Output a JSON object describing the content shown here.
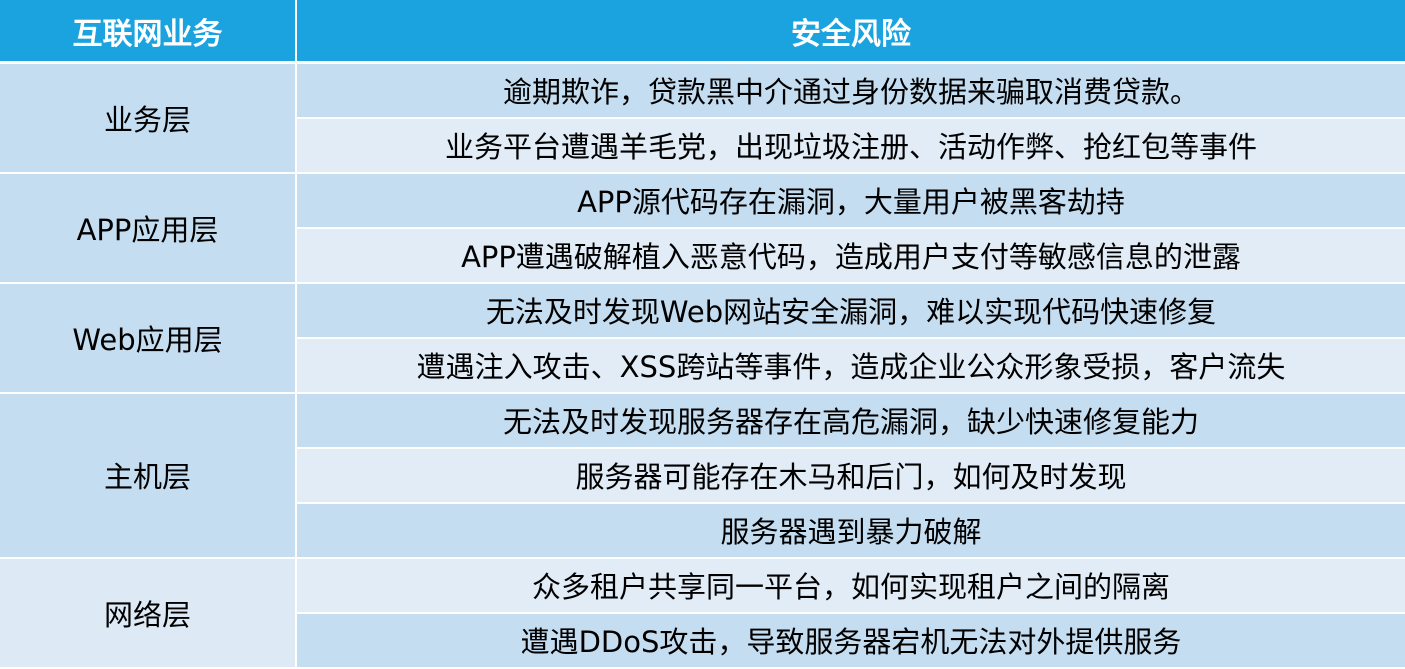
{
  "header": {
    "layer_label": "互联网业务",
    "risk_label": "安全风险"
  },
  "groups": [
    {
      "layer": "业务层",
      "risks": [
        "逾期欺诈，贷款黑中介通过身份数据来骗取消费贷款。",
        "业务平台遭遇羊毛党，出现垃圾注册、活动作弊、抢红包等事件"
      ]
    },
    {
      "layer": "APP应用层",
      "risks": [
        "APP源代码存在漏洞，大量用户被黑客劫持",
        "APP遭遇破解植入恶意代码，造成用户支付等敏感信息的泄露"
      ]
    },
    {
      "layer": "Web应用层",
      "risks": [
        "无法及时发现Web网站安全漏洞，难以实现代码快速修复",
        "遭遇注入攻击、XSS跨站等事件，造成企业公众形象受损，客户流失"
      ]
    },
    {
      "layer": "主机层",
      "risks": [
        "无法及时发现服务器存在高危漏洞，缺少快速修复能力",
        "服务器可能存在木马和后门，如何及时发现",
        "服务器遇到暴力破解"
      ]
    },
    {
      "layer": "网络层",
      "risks": [
        "众多租户共享同一平台，如何实现租户之间的隔离",
        "遭遇DDoS攻击，导致服务器宕机无法对外提供服务"
      ]
    }
  ],
  "colors": {
    "header_bg": "#1ba3e0",
    "row_dark": "#c5ddf0",
    "row_light": "#e1ecf7"
  }
}
